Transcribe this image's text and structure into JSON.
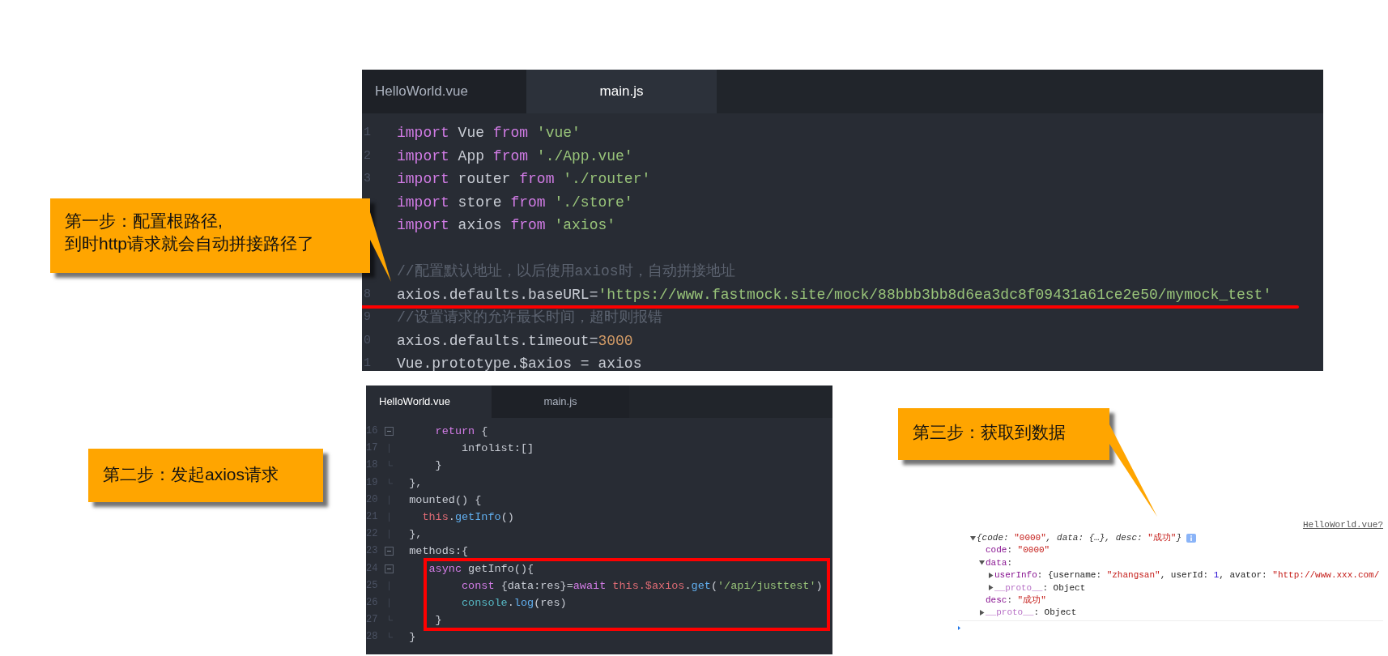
{
  "editors": [
    {
      "tabs": [
        {
          "label": "HelloWorld.vue",
          "selected": false
        },
        {
          "label": "main.js",
          "selected": true
        }
      ],
      "lines": [
        {
          "num": "1",
          "tokens": [
            {
              "kind": "kw",
              "text": "import"
            },
            {
              "kind": "plain",
              "text": " Vue "
            },
            {
              "kind": "kw",
              "text": "from "
            },
            {
              "kind": "str",
              "text": "'vue'"
            }
          ]
        },
        {
          "num": "2",
          "tokens": [
            {
              "kind": "kw",
              "text": "import"
            },
            {
              "kind": "plain",
              "text": " App "
            },
            {
              "kind": "kw",
              "text": "from "
            },
            {
              "kind": "str",
              "text": "'./App.vue'"
            }
          ]
        },
        {
          "num": "3",
          "tokens": [
            {
              "kind": "kw",
              "text": "import"
            },
            {
              "kind": "plain",
              "text": " router "
            },
            {
              "kind": "kw",
              "text": "from "
            },
            {
              "kind": "str",
              "text": "'./router'"
            }
          ]
        },
        {
          "tokens": [
            {
              "kind": "kw",
              "text": "import"
            },
            {
              "kind": "plain",
              "text": " store "
            },
            {
              "kind": "kw",
              "text": "from "
            },
            {
              "kind": "str",
              "text": "'./store'"
            }
          ]
        },
        {
          "tokens": [
            {
              "kind": "kw",
              "text": "import"
            },
            {
              "kind": "plain",
              "text": " axios "
            },
            {
              "kind": "kw",
              "text": "from "
            },
            {
              "kind": "str",
              "text": "'axios'"
            }
          ]
        },
        {
          "kind": "blank"
        },
        {
          "tokens": [
            {
              "kind": "comment",
              "text": "//配置默认地址，以后使用axios时，自动拼接地址"
            }
          ]
        },
        {
          "num": "8",
          "underlined": true,
          "tokens": [
            {
              "kind": "plain",
              "text": "axios.defaults.baseURL="
            },
            {
              "kind": "str",
              "text": "'https://www.fastmock.site/mock/88bbb3bb8d6ea3dc8f09431a61ce2e50/mymock_test'"
            }
          ]
        },
        {
          "num": "9",
          "tokens": [
            {
              "kind": "comment",
              "text": "//设置请求的允许最长时间，超时则报错"
            }
          ]
        },
        {
          "num": "0",
          "tokens": [
            {
              "kind": "plain",
              "text": "axios.defaults.timeout="
            },
            {
              "kind": "num",
              "text": "3000"
            }
          ]
        },
        {
          "num": "1",
          "tokens": [
            {
              "kind": "plain",
              "text": "Vue.prototype.$axios = axios"
            }
          ]
        }
      ]
    },
    {
      "tabs": [
        {
          "label": "HelloWorld.vue",
          "selected": true
        },
        {
          "label": "main.js",
          "selected": false
        }
      ],
      "lines": [
        {
          "num": "16",
          "kind": "fold",
          "tokens": [
            {
              "kind": "kw",
              "text": "      return"
            },
            {
              "kind": "plain",
              "text": " {"
            }
          ]
        },
        {
          "num": "17",
          "kind": "line",
          "tokens": [
            {
              "kind": "plain",
              "text": "          infolist:[]"
            }
          ]
        },
        {
          "num": "18",
          "kind": "end",
          "tokens": [
            {
              "kind": "plain",
              "text": "      }"
            }
          ]
        },
        {
          "num": "19",
          "kind": "end",
          "tokens": [
            {
              "kind": "plain",
              "text": "  },"
            }
          ]
        },
        {
          "num": "20",
          "kind": "line",
          "tokens": [
            {
              "kind": "plain",
              "text": "  mounted() {"
            }
          ]
        },
        {
          "num": "21",
          "kind": "line",
          "tokens": [
            {
              "kind": "this",
              "text": "    this"
            },
            {
              "kind": "plain",
              "text": "."
            },
            {
              "kind": "fn",
              "text": "getInfo"
            },
            {
              "kind": "plain",
              "text": "()"
            }
          ]
        },
        {
          "num": "22",
          "kind": "line",
          "tokens": [
            {
              "kind": "plain",
              "text": "  },"
            }
          ]
        },
        {
          "num": "23",
          "kind": "fold",
          "tokens": [
            {
              "kind": "plain",
              "text": "  methods:{"
            }
          ]
        },
        {
          "num": "24",
          "kind": "fold",
          "boxed": true,
          "tokens": [
            {
              "kind": "kw",
              "text": "     async"
            },
            {
              "kind": "plain",
              "text": " getInfo(){"
            }
          ]
        },
        {
          "num": "25",
          "kind": "line",
          "boxed": true,
          "tokens": [
            {
              "kind": "kw",
              "text": "          const"
            },
            {
              "kind": "plain",
              "text": " {data:res}="
            },
            {
              "kind": "kw",
              "text": "await "
            },
            {
              "kind": "this",
              "text": "this.$axios"
            },
            {
              "kind": "plain",
              "text": "."
            },
            {
              "kind": "fn",
              "text": "get"
            },
            {
              "kind": "plain",
              "text": "("
            },
            {
              "kind": "str",
              "text": "'/api/justtest'"
            },
            {
              "kind": "plain",
              "text": ")"
            }
          ]
        },
        {
          "num": "26",
          "kind": "line",
          "boxed": true,
          "tokens": [
            {
              "kind": "cyan",
              "text": "          console"
            },
            {
              "kind": "plain",
              "text": "."
            },
            {
              "kind": "fn",
              "text": "log"
            },
            {
              "kind": "plain",
              "text": "(res)"
            }
          ]
        },
        {
          "num": "27",
          "kind": "end",
          "boxed": true,
          "tokens": [
            {
              "kind": "plain",
              "text": "      }"
            }
          ]
        },
        {
          "num": "28",
          "kind": "end",
          "tokens": [
            {
              "kind": "plain",
              "text": "  }"
            }
          ]
        }
      ]
    }
  ],
  "console": {
    "source": "HelloWorld.vue?",
    "entries": [
      {
        "kind": "branch",
        "expanded": true,
        "info": true,
        "tokens": [
          {
            "kind": "meta",
            "text": "{code: "
          },
          {
            "kind": "str",
            "text": "\"0000\""
          },
          {
            "kind": "meta",
            "text": ", data: {…}, desc: "
          },
          {
            "kind": "str",
            "text": "\"成功\""
          },
          {
            "kind": "meta",
            "text": "}"
          }
        ],
        "children": [
          {
            "kind": "leaf",
            "tokens": [
              {
                "kind": "key",
                "text": "code"
              },
              {
                "kind": "plain",
                "text": ": "
              },
              {
                "kind": "str",
                "text": "\"0000\""
              }
            ]
          },
          {
            "kind": "branch",
            "expanded": true,
            "tokens": [
              {
                "kind": "key",
                "text": "data"
              },
              {
                "kind": "plain",
                "text": ":"
              }
            ],
            "children": [
              {
                "kind": "branch",
                "expanded": false,
                "tokens": [
                  {
                    "kind": "key",
                    "text": "userInfo"
                  },
                  {
                    "kind": "plain",
                    "text": ": {username: "
                  },
                  {
                    "kind": "str",
                    "text": "\"zhangsan\""
                  },
                  {
                    "kind": "plain",
                    "text": ", userId: "
                  },
                  {
                    "kind": "num",
                    "text": "1"
                  },
                  {
                    "kind": "plain",
                    "text": ", avator: "
                  },
                  {
                    "kind": "str",
                    "text": "\"http://www.xxx.com/"
                  }
                ]
              },
              {
                "kind": "branch",
                "expanded": false,
                "tokens": [
                  {
                    "kind": "proto",
                    "text": "__proto__"
                  },
                  {
                    "kind": "plain",
                    "text": ": Object"
                  }
                ]
              }
            ]
          },
          {
            "kind": "leaf",
            "tokens": [
              {
                "kind": "key",
                "text": "desc"
              },
              {
                "kind": "plain",
                "text": ": "
              },
              {
                "kind": "str",
                "text": "\"成功\""
              }
            ]
          },
          {
            "kind": "branch",
            "expanded": false,
            "tokens": [
              {
                "kind": "proto",
                "text": "__proto__"
              },
              {
                "kind": "plain",
                "text": ": Object"
              }
            ]
          }
        ]
      }
    ]
  },
  "callouts": [
    {
      "lines": [
        "第一步：配置根路径,",
        "到时http请求就会自动拼接路径了"
      ]
    },
    {
      "lines": [
        "第二步：发起axios请求"
      ]
    },
    {
      "lines": [
        "第三步：获取到数据"
      ]
    }
  ]
}
